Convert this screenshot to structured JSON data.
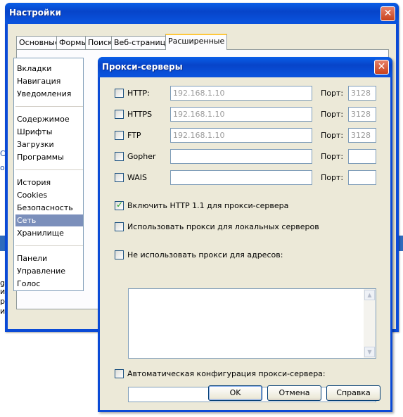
{
  "settings_window": {
    "title": "Настройки",
    "close_glyph": "✕",
    "tabs": [
      "Основные",
      "Формы",
      "Поиск",
      "Веб-страницы",
      "Расширенные"
    ],
    "active_tab": "Расширенные",
    "categories": [
      [
        "Вкладки",
        "Навигация",
        "Уведомления"
      ],
      [
        "Содержимое",
        "Шрифты",
        "Загрузки",
        "Программы"
      ],
      [
        "История",
        "Cookies",
        "Безопасность",
        "Сеть",
        "Хранилище"
      ],
      [
        "Панели",
        "Управление",
        "Голос"
      ]
    ],
    "selected_category": "Сеть"
  },
  "background_fragments": [
    "С",
    "о",
    "g",
    "и",
    "р",
    "и"
  ],
  "proxy_dialog": {
    "title": "Прокси-серверы",
    "close_glyph": "✕",
    "port_label": "Порт:",
    "rows": [
      {
        "protocol": "HTTP:",
        "checked": false,
        "address": "192.168.1.10",
        "port": "3128",
        "disabled": true
      },
      {
        "protocol": "HTTPS",
        "checked": false,
        "address": "192.168.1.10",
        "port": "3128",
        "disabled": true
      },
      {
        "protocol": "FTP",
        "checked": false,
        "address": "192.168.1.10",
        "port": "3128",
        "disabled": true
      },
      {
        "protocol": "Gopher",
        "checked": false,
        "address": "",
        "port": "",
        "disabled": false
      },
      {
        "protocol": "WAIS",
        "checked": false,
        "address": "",
        "port": "",
        "disabled": false
      }
    ],
    "options": {
      "http11": {
        "label": "Включить HTTP 1.1 для прокси-сервера",
        "checked": true
      },
      "local": {
        "label": "Использовать прокси для локальных серверов",
        "checked": false
      },
      "no_proxy": {
        "label": "Не использовать прокси для адресов:",
        "checked": false
      },
      "auto_config": {
        "label": "Автоматическая конфигурация прокси-сервера:",
        "checked": false
      }
    },
    "no_proxy_list": "",
    "auto_config_url": "",
    "buttons": {
      "ok": "OK",
      "cancel": "Отмена",
      "help": "Справка"
    },
    "scroll_up_glyph": "▲",
    "scroll_down_glyph": "▼"
  }
}
